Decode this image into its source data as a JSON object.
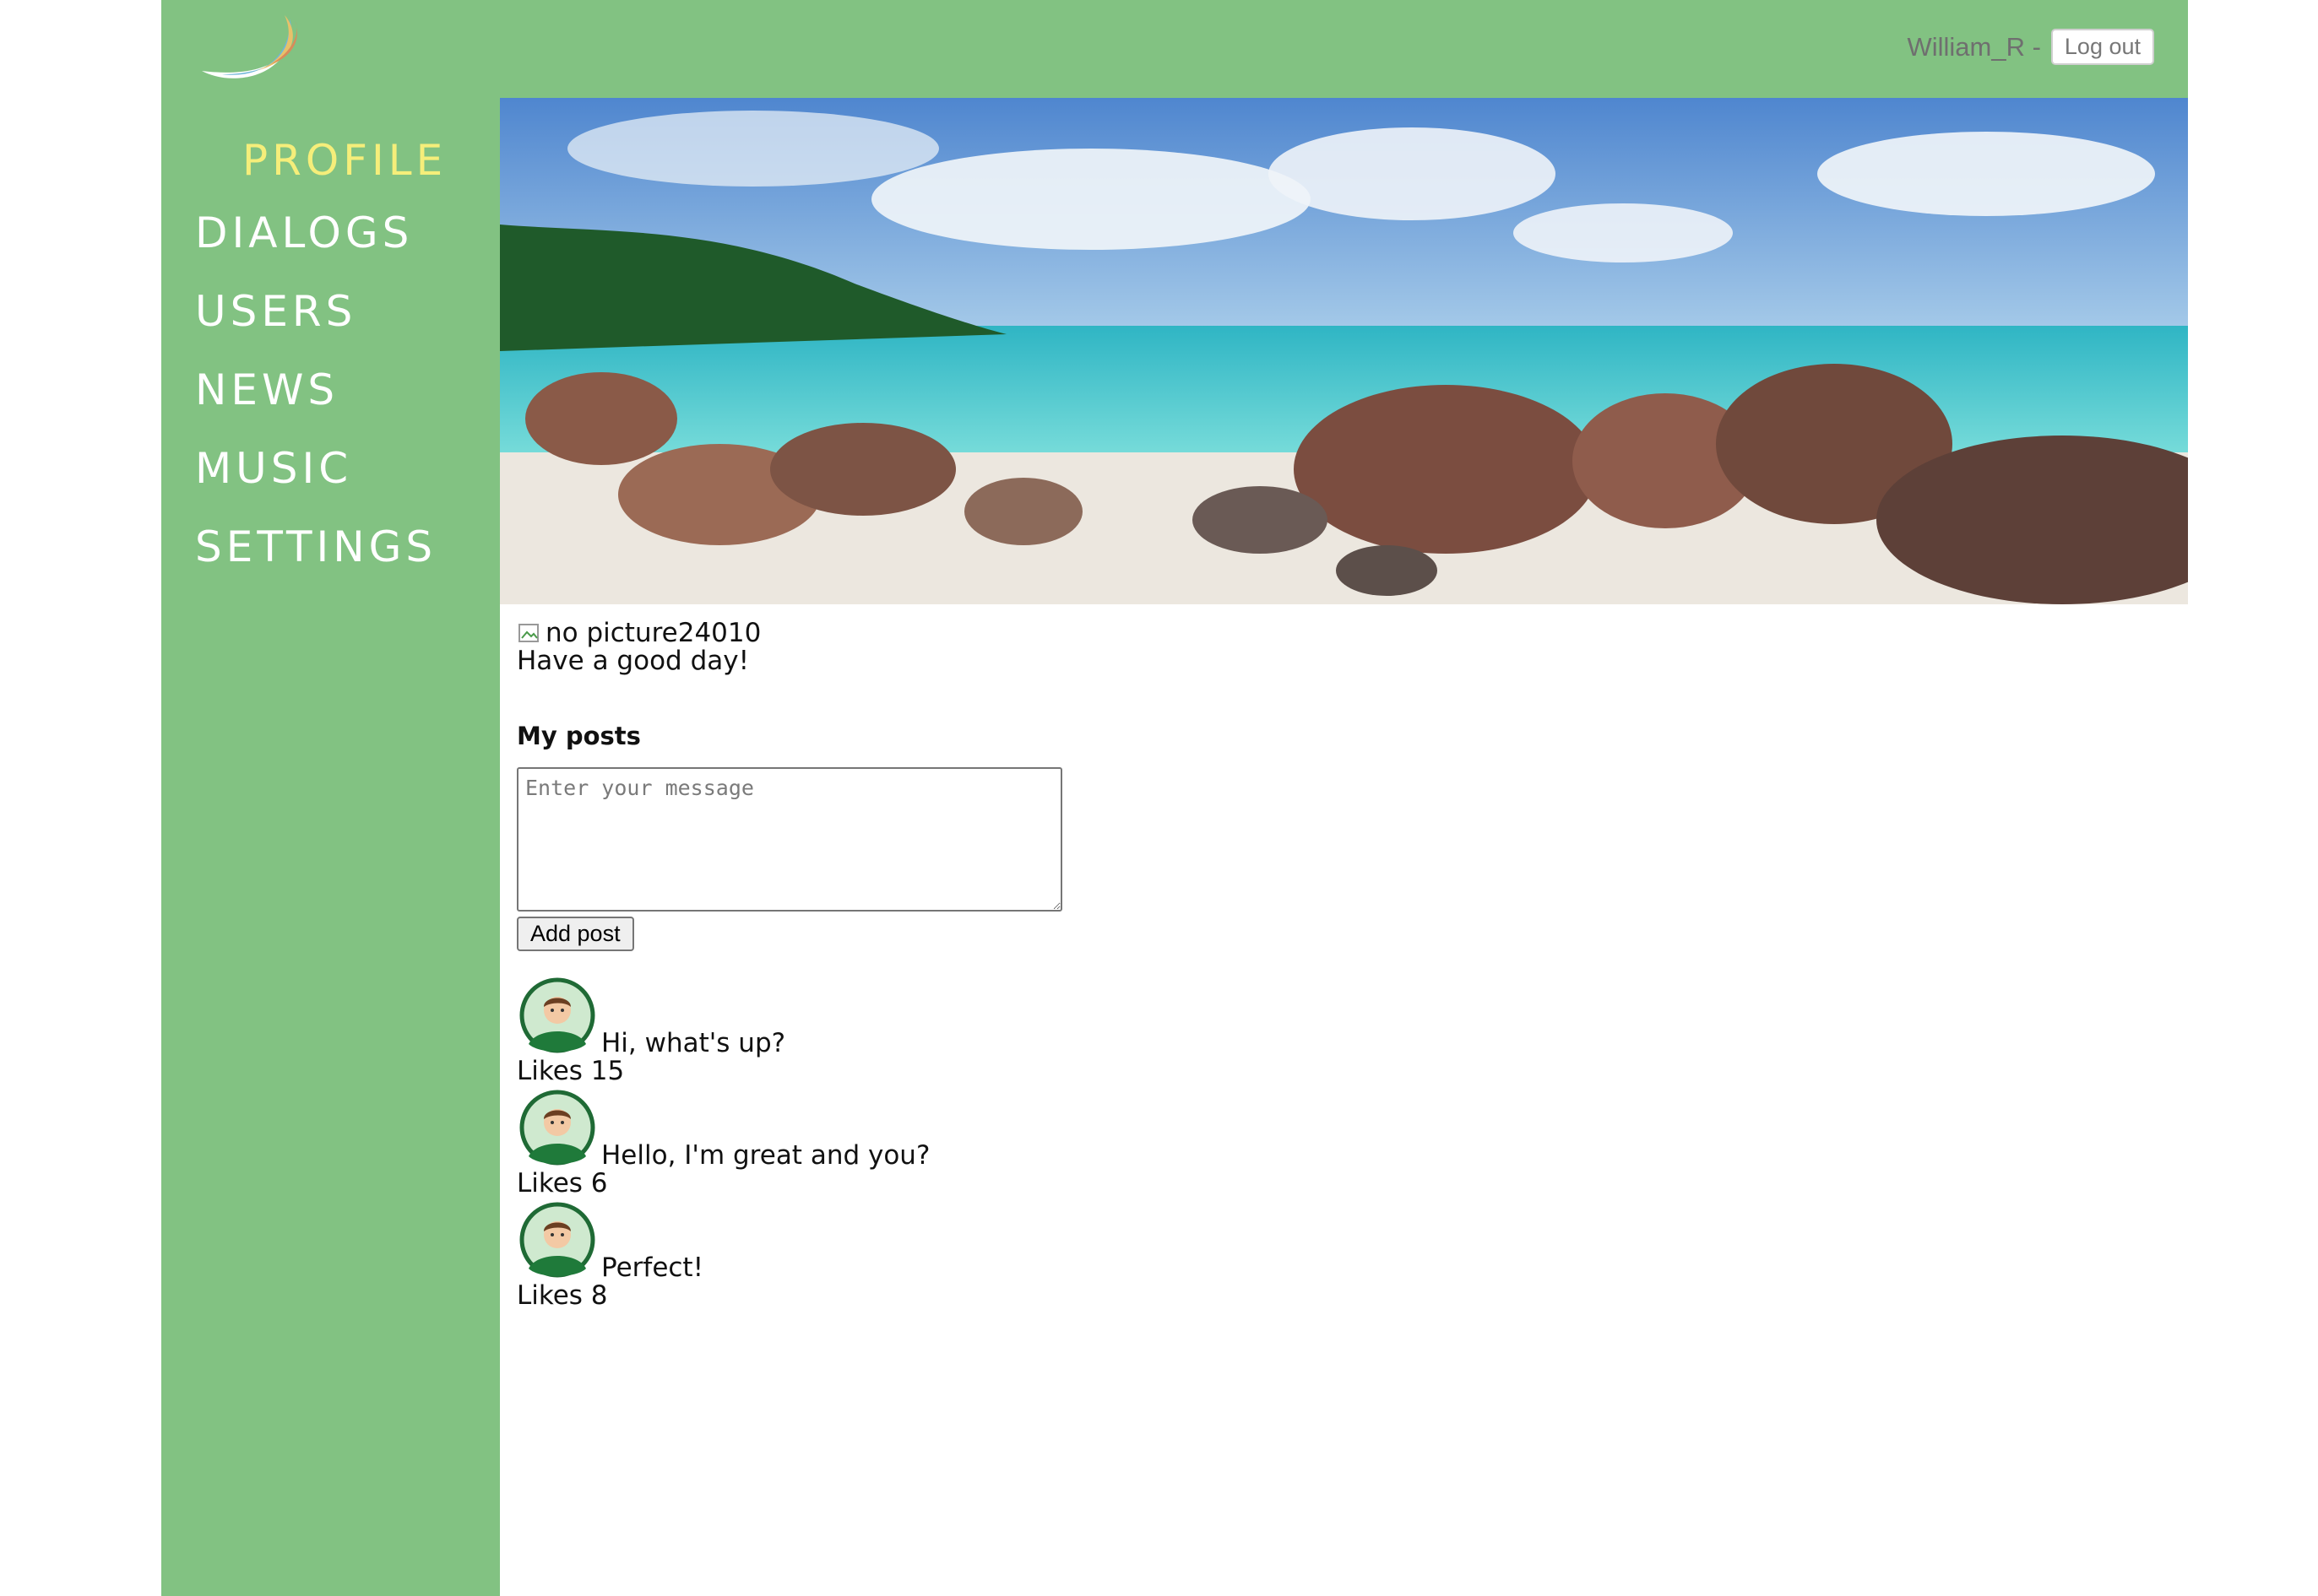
{
  "header": {
    "logo_icon": "crescent-logo-icon",
    "login_name": "William_R -",
    "logout_label": "Log out"
  },
  "nav": {
    "items": [
      {
        "label": "PROFILE",
        "active": true
      },
      {
        "label": "DIALOGS"
      },
      {
        "label": "USERS"
      },
      {
        "label": "NEWS"
      },
      {
        "label": "MUSIC"
      },
      {
        "label": "SETTINGS"
      }
    ]
  },
  "profile": {
    "avatar_alt": "no picture24010",
    "status": "Have a good day!"
  },
  "posts": {
    "title": "My posts",
    "input_placeholder": "Enter your message",
    "add_label": "Add post",
    "likes_prefix": "Likes",
    "items": [
      {
        "message": "Hi, what's up?",
        "likes": "Likes 15"
      },
      {
        "message": "Hello, I'm great and you?",
        "likes": "Likes 6"
      },
      {
        "message": "Perfect!",
        "likes": "Likes 8"
      }
    ]
  },
  "colors": {
    "primary_green": "#82c282",
    "active_nav": "#f5ee7a"
  }
}
